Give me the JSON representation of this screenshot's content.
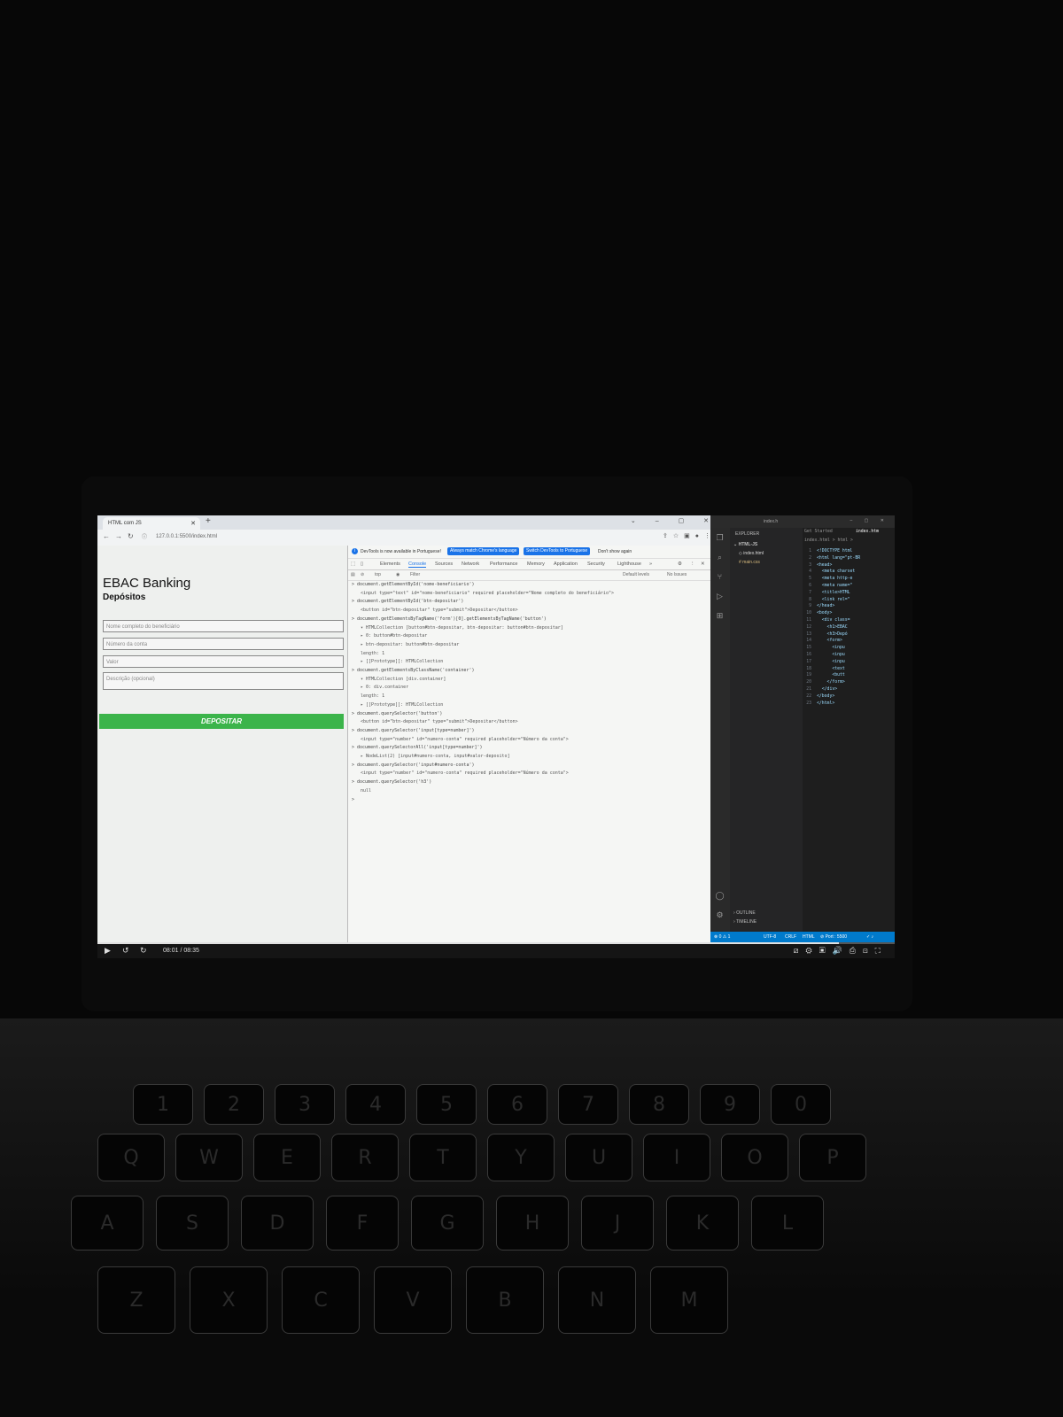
{
  "browser": {
    "tab_title": "HTML com JS",
    "url": "127.0.0.1:5500/index.html"
  },
  "page": {
    "title": "EBAC Banking",
    "subtitle": "Depósitos",
    "fields": [
      "Nome completo do beneficiário",
      "Número da conta",
      "Valor",
      "Descrição (opcional)"
    ],
    "submit_label": "DEPOSITAR"
  },
  "devtools": {
    "info_message": "DevTools is now available in Portuguese!",
    "btn_match": "Always match Chrome's language",
    "btn_switch": "Switch DevTools to Portuguese",
    "btn_dont_show": "Don't show again",
    "tabs": [
      "Elements",
      "Console",
      "Sources",
      "Network",
      "Performance",
      "Memory",
      "Application",
      "Security",
      "Lighthouse"
    ],
    "active_tab": "Console",
    "context": "top",
    "filter_placeholder": "Filter",
    "levels": "Default levels",
    "issues": "No Issues",
    "console_lines": [
      "> document.getElementById('nome-beneficiario')",
      "<input type=\"text\" id=\"nome-beneficiario\" required placeholder=\"Nome completo do beneficiário\">",
      "> document.getElementById('btn-depositar')",
      "<button id=\"btn-depositar\" type=\"submit\">Depositar</button>",
      "> document.getElementsByTagName('form')[0].getElementsByTagName('button')",
      "▾ HTMLCollection [button#btn-depositar, btn-depositar: button#btn-depositar]",
      "▸ 0: button#btn-depositar",
      "▸ btn-depositar: button#btn-depositar",
      "length: 1",
      "▸ [[Prototype]]: HTMLCollection",
      "> document.getElementsByClassName('container')",
      "▾ HTMLCollection [div.container]",
      "▸ 0: div.container",
      "length: 1",
      "▸ [[Prototype]]: HTMLCollection",
      "> document.querySelector('button')",
      "<button id=\"btn-depositar\" type=\"submit\">Depositar</button>",
      "> document.querySelector('input[type=number]')",
      "<input type=\"number\" id=\"numero-conta\" required placeholder=\"Número da conta\">",
      "> document.querySelectorAll('input[type=number]')",
      "▸ NodeList(2) [input#numero-conta, input#valor-deposito]",
      "> document.querySelector('input#numero-conta')",
      "<input type=\"number\" id=\"numero-conta\" required placeholder=\"Número da conta\">",
      "> document.querySelector('h3')",
      "null",
      ">"
    ]
  },
  "vscode": {
    "title": "index.h",
    "explorer_label": "EXPLORER",
    "folder": "HTML-JS",
    "files": [
      "index.html",
      "main.css"
    ],
    "tab_get_started": "Get Started",
    "tab_index": "index.htm",
    "breadcrumb": "index.html > html > ",
    "outline": "OUTLINE",
    "timeline": "TIMELINE",
    "line_numbers": [
      "1",
      "2",
      "3",
      "4",
      "5",
      "6",
      "7",
      "8",
      "9",
      "10",
      "11",
      "12",
      "13",
      "14",
      "15",
      "16",
      "17",
      "18",
      "19",
      "20",
      "21",
      "22",
      "23"
    ],
    "code_lines": [
      "<!DOCTYPE html",
      "<html lang=\"pt-BR",
      "<head>",
      "  <meta charset",
      "  <meta http-e",
      "  <meta name=\"",
      "  <title>HTML",
      "  <link rel=\"",
      "</head>",
      "<body>",
      "  <div class=",
      "    <h1>EBAC",
      "    <h3>Depó",
      "    <form>",
      "      <inpu",
      "      <inpu",
      "      <inpu",
      "      <text",
      "      <butt",
      "    </form>",
      "  </div>",
      "</body>",
      "</html>"
    ],
    "status_errors": "⊗ 0 ⚠ 1",
    "status_encoding": "UTF-8",
    "status_eol": "CRLF",
    "status_lang": "HTML",
    "status_port": "⊘ Port : 5500"
  },
  "player": {
    "time": "08:01 / 08:35",
    "progress": 0.93
  },
  "keyboard": {
    "row_numbers": [
      "1",
      "2",
      "3",
      "4",
      "5",
      "6",
      "7",
      "8",
      "9",
      "0"
    ],
    "row_letters_upper": [
      "Q",
      "W",
      "E",
      "R",
      "T",
      "Y",
      "U",
      "I",
      "O",
      "P"
    ],
    "row_letters_mid": [
      "A",
      "S",
      "D",
      "F",
      "G",
      "H",
      "J",
      "K",
      "L"
    ],
    "row_letters_low": [
      "Z",
      "X",
      "C",
      "V",
      "B",
      "N",
      "M"
    ]
  }
}
